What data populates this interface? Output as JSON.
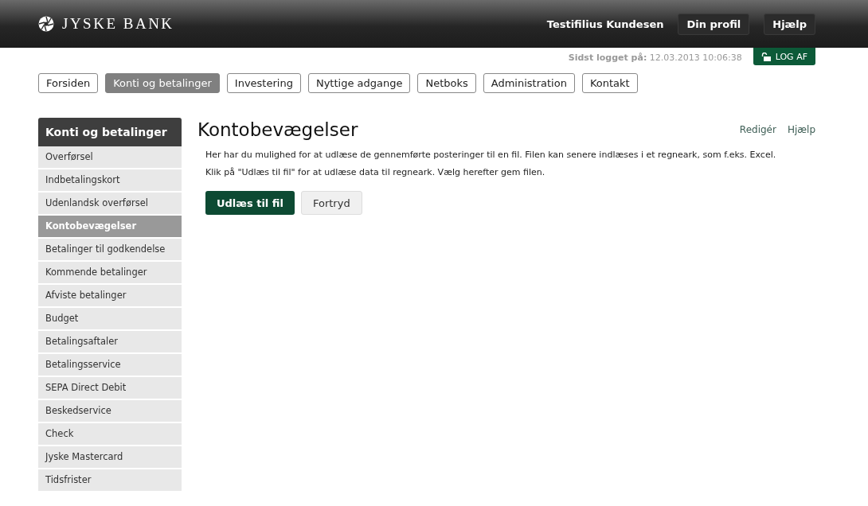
{
  "header": {
    "logo": "JYSKE BANK",
    "user_name": "Testifilius Kundesen",
    "buttons": [
      "Din profil",
      "Hjælp"
    ]
  },
  "session": {
    "last_login": "**Sidst logget på:** 12.03.2013 10:06:38",
    "logout": "LOG AF"
  },
  "tabs": [
    {
      "label": "Forsiden",
      "selected": false
    },
    {
      "label": "Konti og betalinger",
      "selected": true
    },
    {
      "label": "Investering",
      "selected": false
    },
    {
      "label": "Nyttige adgange",
      "selected": false
    },
    {
      "label": "Netboks",
      "selected": false
    },
    {
      "label": "Administration",
      "selected": false
    },
    {
      "label": "Kontakt",
      "selected": false
    }
  ],
  "sidebar": {
    "title": "Konti og betalinger",
    "items": [
      {
        "label": "Overførsel",
        "selected": false
      },
      {
        "label": "Indbetalingskort",
        "selected": false
      },
      {
        "label": "Udenlandsk overførsel",
        "selected": false
      },
      {
        "label": "Kontobevægelser",
        "selected": true
      },
      {
        "label": "Betalinger til godkendelse",
        "selected": false
      },
      {
        "label": "Kommende betalinger",
        "selected": false
      },
      {
        "label": "Afviste betalinger",
        "selected": false
      },
      {
        "label": "Budget",
        "selected": false
      },
      {
        "label": "Betalingsaftaler",
        "selected": false
      },
      {
        "label": "Betalingsservice",
        "selected": false
      },
      {
        "label": "SEPA Direct Debit",
        "selected": false
      },
      {
        "label": "Beskedservice",
        "selected": false
      },
      {
        "label": "Check",
        "selected": false
      },
      {
        "label": "Jyske Mastercard",
        "selected": false
      },
      {
        "label": "Tidsfrister",
        "selected": false
      }
    ]
  },
  "main": {
    "title": "Kontobevægelser",
    "links": [
      "Redigér",
      "Hjælp"
    ],
    "paragraphs": [
      "Her har du mulighed for at udlæse de gennemførte posteringer til en fil. Filen kan senere indlæses i et regneark, som f.eks. Excel.",
      "Klik på \"Udlæs til fil\" for at udlæse data til regneark. Vælg herefter gem filen."
    ],
    "buttons": [
      {
        "label": "Udlæs til fil",
        "kind": "primary"
      },
      {
        "label": "Fortryd",
        "kind": "secondary"
      }
    ]
  }
}
